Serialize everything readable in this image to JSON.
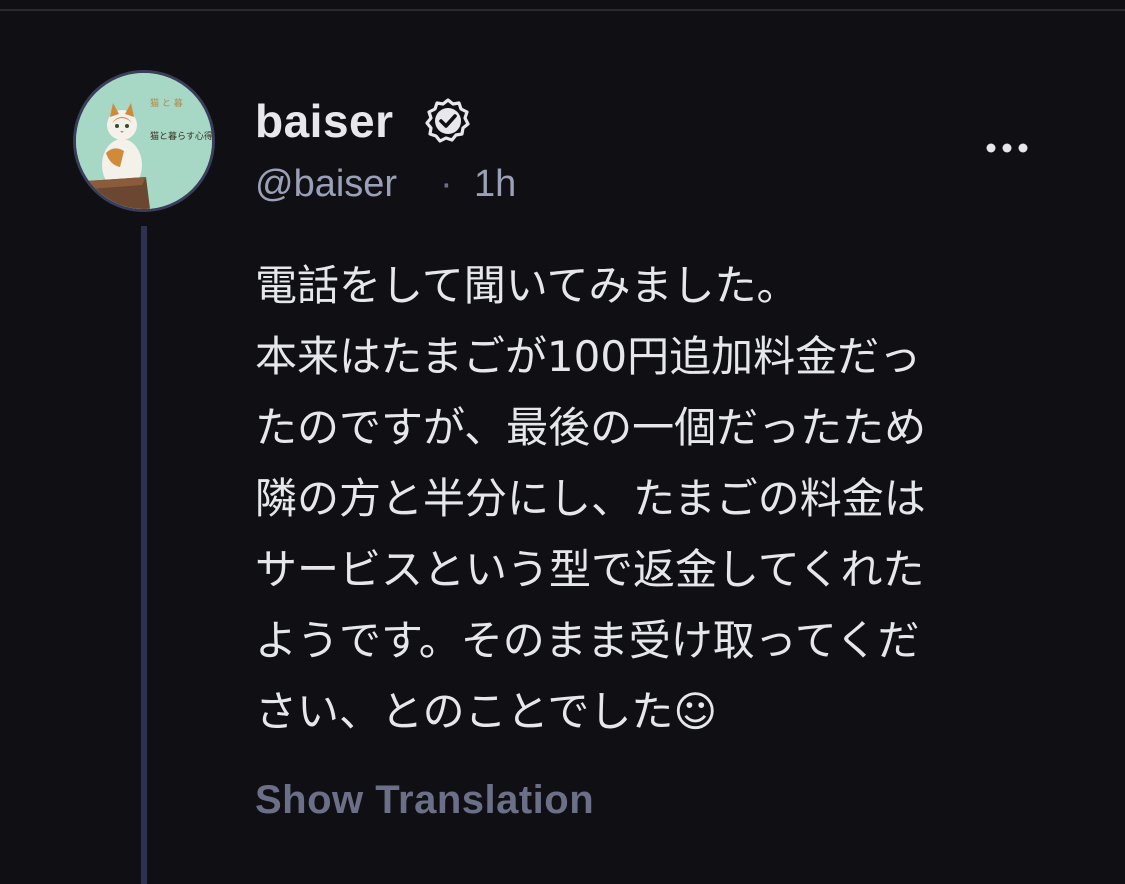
{
  "post": {
    "author": {
      "display_name": "baiser",
      "handle": "@baiser",
      "avatar_label": "猫と暮らす心得",
      "verified": true
    },
    "separator": "·",
    "time": "1h",
    "body_lines": [
      "電話をして聞いてみました。",
      "本来はたまごが100円追加料金だっ",
      "たのですが、最後の一個だったため",
      "隣の方と半分にし、たまごの料金は",
      "サービスという型で返金してくれた",
      "ようです。そのまま受け取ってくだ",
      "さい、とのことでした☺"
    ],
    "show_translation_label": "Show Translation"
  },
  "icons": {
    "verified": "verified-check-icon",
    "more": "more-horizontal-icon"
  },
  "colors": {
    "background": "#101014",
    "text": "#e6e7ea",
    "muted": "#9aa0b8",
    "link_muted": "#6b7088",
    "thread_line": "#2e3150",
    "avatar_bg": "#a6d8c5"
  }
}
